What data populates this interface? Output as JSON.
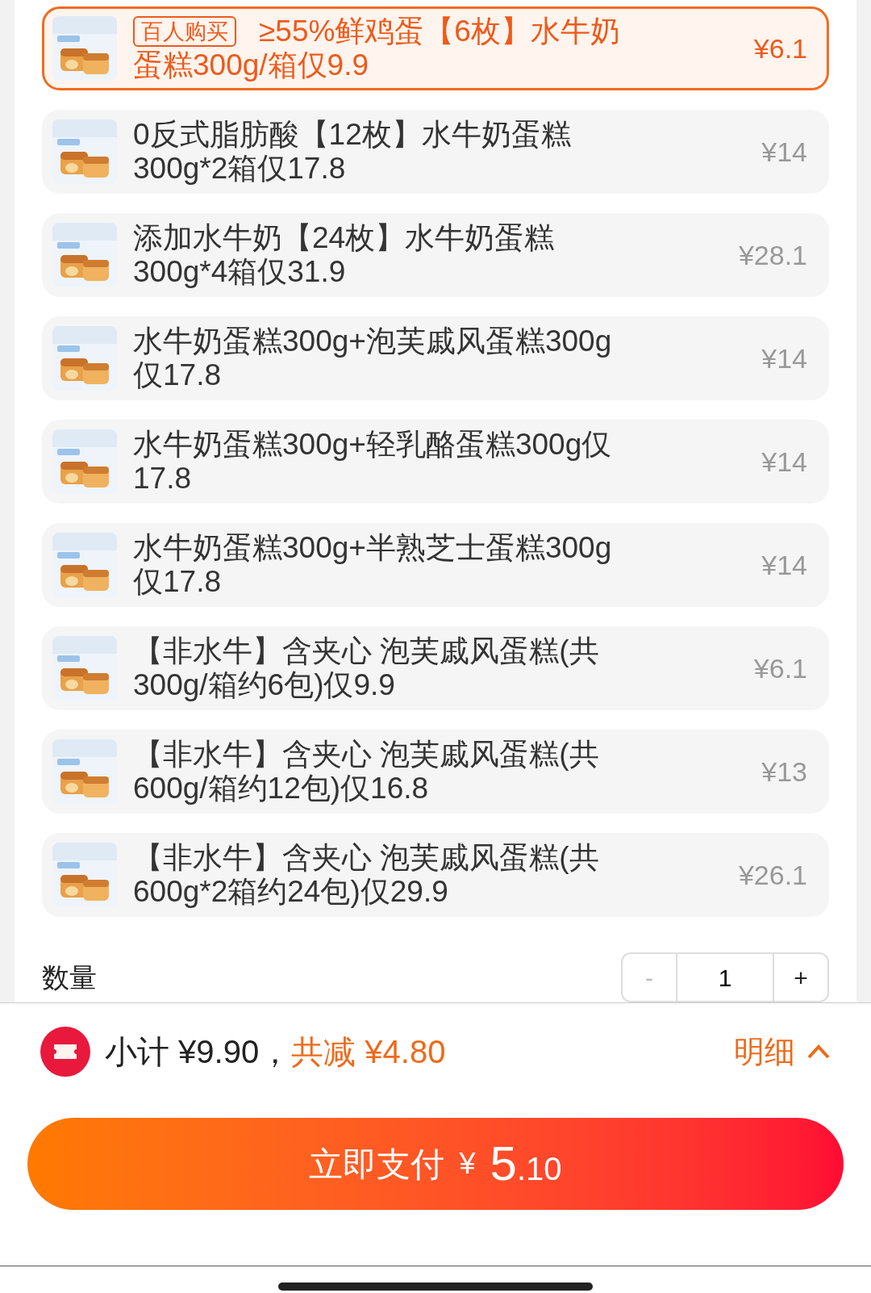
{
  "options": [
    {
      "badge": "百人购买",
      "title_lines": [
        "≥55%鲜鸡蛋【6枚】水牛奶",
        "蛋糕300g/箱仅9.9"
      ],
      "price": "¥6.1",
      "selected": true
    },
    {
      "title_lines": [
        "0反式脂肪酸【12枚】水牛奶蛋糕",
        "300g*2箱仅17.8"
      ],
      "price": "¥14",
      "selected": false
    },
    {
      "title_lines": [
        "添加水牛奶【24枚】水牛奶蛋糕",
        "300g*4箱仅31.9"
      ],
      "price": "¥28.1",
      "selected": false
    },
    {
      "title_lines": [
        "水牛奶蛋糕300g+泡芙戚风蛋糕300g",
        "仅17.8"
      ],
      "price": "¥14",
      "selected": false
    },
    {
      "title_lines": [
        "水牛奶蛋糕300g+轻乳酪蛋糕300g仅",
        "17.8"
      ],
      "price": "¥14",
      "selected": false
    },
    {
      "title_lines": [
        "水牛奶蛋糕300g+半熟芝士蛋糕300g",
        "仅17.8"
      ],
      "price": "¥14",
      "selected": false
    },
    {
      "title_lines": [
        "【非水牛】含夹心 泡芙戚风蛋糕(共",
        "300g/箱约6包)仅9.9"
      ],
      "price": "¥6.1",
      "selected": false
    },
    {
      "title_lines": [
        "【非水牛】含夹心 泡芙戚风蛋糕(共",
        "600g/箱约12包)仅16.8"
      ],
      "price": "¥13",
      "selected": false
    },
    {
      "title_lines": [
        "【非水牛】含夹心 泡芙戚风蛋糕(共",
        "600g*2箱约24包)仅29.9"
      ],
      "price": "¥26.1",
      "selected": false
    }
  ],
  "quantity": {
    "label": "数量",
    "minus": "-",
    "value": "1",
    "plus": "+"
  },
  "summary": {
    "subtotal": "小计 ¥9.90，",
    "discount": "共减 ¥4.80",
    "details": "明细"
  },
  "pay_button": {
    "label": "立即支付",
    "currency": "¥",
    "amount": "5",
    "cents": ".10"
  }
}
